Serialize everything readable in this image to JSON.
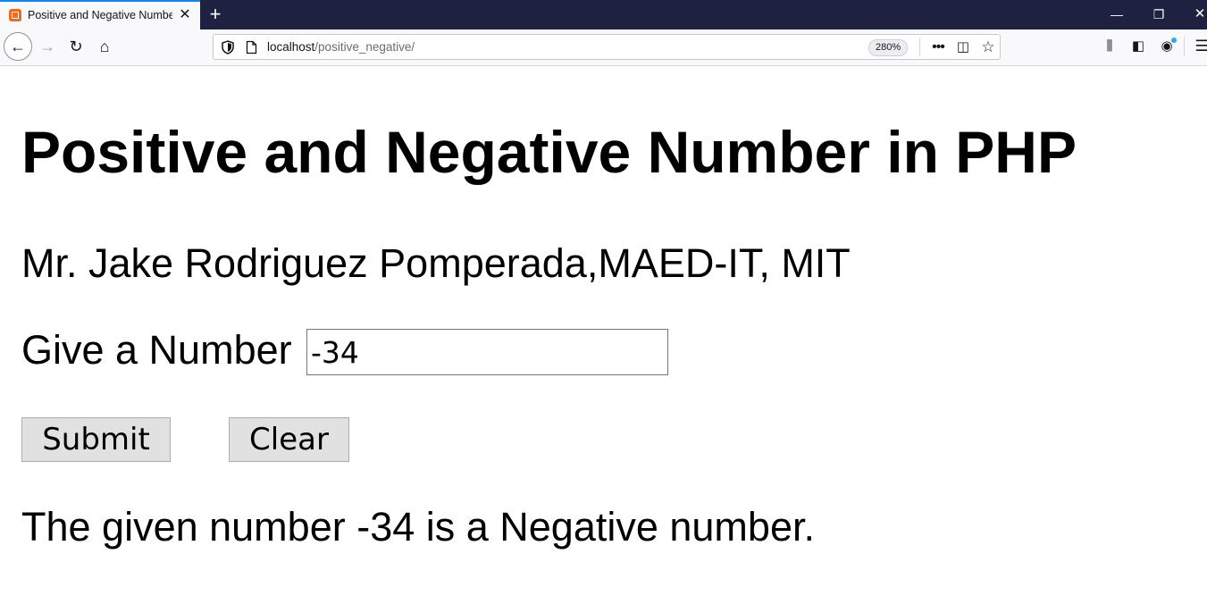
{
  "browser": {
    "tab": {
      "title": "Positive and Negative Number",
      "favicon": "xampp-icon",
      "close_symbol": "✕"
    },
    "new_tab_symbol": "+",
    "window_controls": {
      "minimize": "—",
      "restore": "❐",
      "close": "✕"
    },
    "nav": {
      "back": "←",
      "forward": "→",
      "reload": "↻",
      "home": "⌂"
    },
    "url": {
      "host": "localhost",
      "path": "/positive_negative/"
    },
    "zoom_label": "280%",
    "url_actions": {
      "more": "•••",
      "pocket": "◫",
      "bookmark": "☆"
    },
    "toolbar_icons": {
      "library": "⫼",
      "sidebar": "◧",
      "account": "◉",
      "menu": "☰"
    },
    "colors": {
      "titlebar": "#1f2140",
      "tab_accent": "#0a84ff",
      "notification_dot": "#2aa7f5"
    }
  },
  "page": {
    "title": "Positive and Negative Number in PHP",
    "author": "Mr. Jake Rodriguez Pomperada,MAED-IT, MIT",
    "input_label": "Give a Number",
    "input_value": "-34",
    "submit_label": "Submit",
    "clear_label": "Clear",
    "result": "The given number -34 is a Negative number."
  }
}
